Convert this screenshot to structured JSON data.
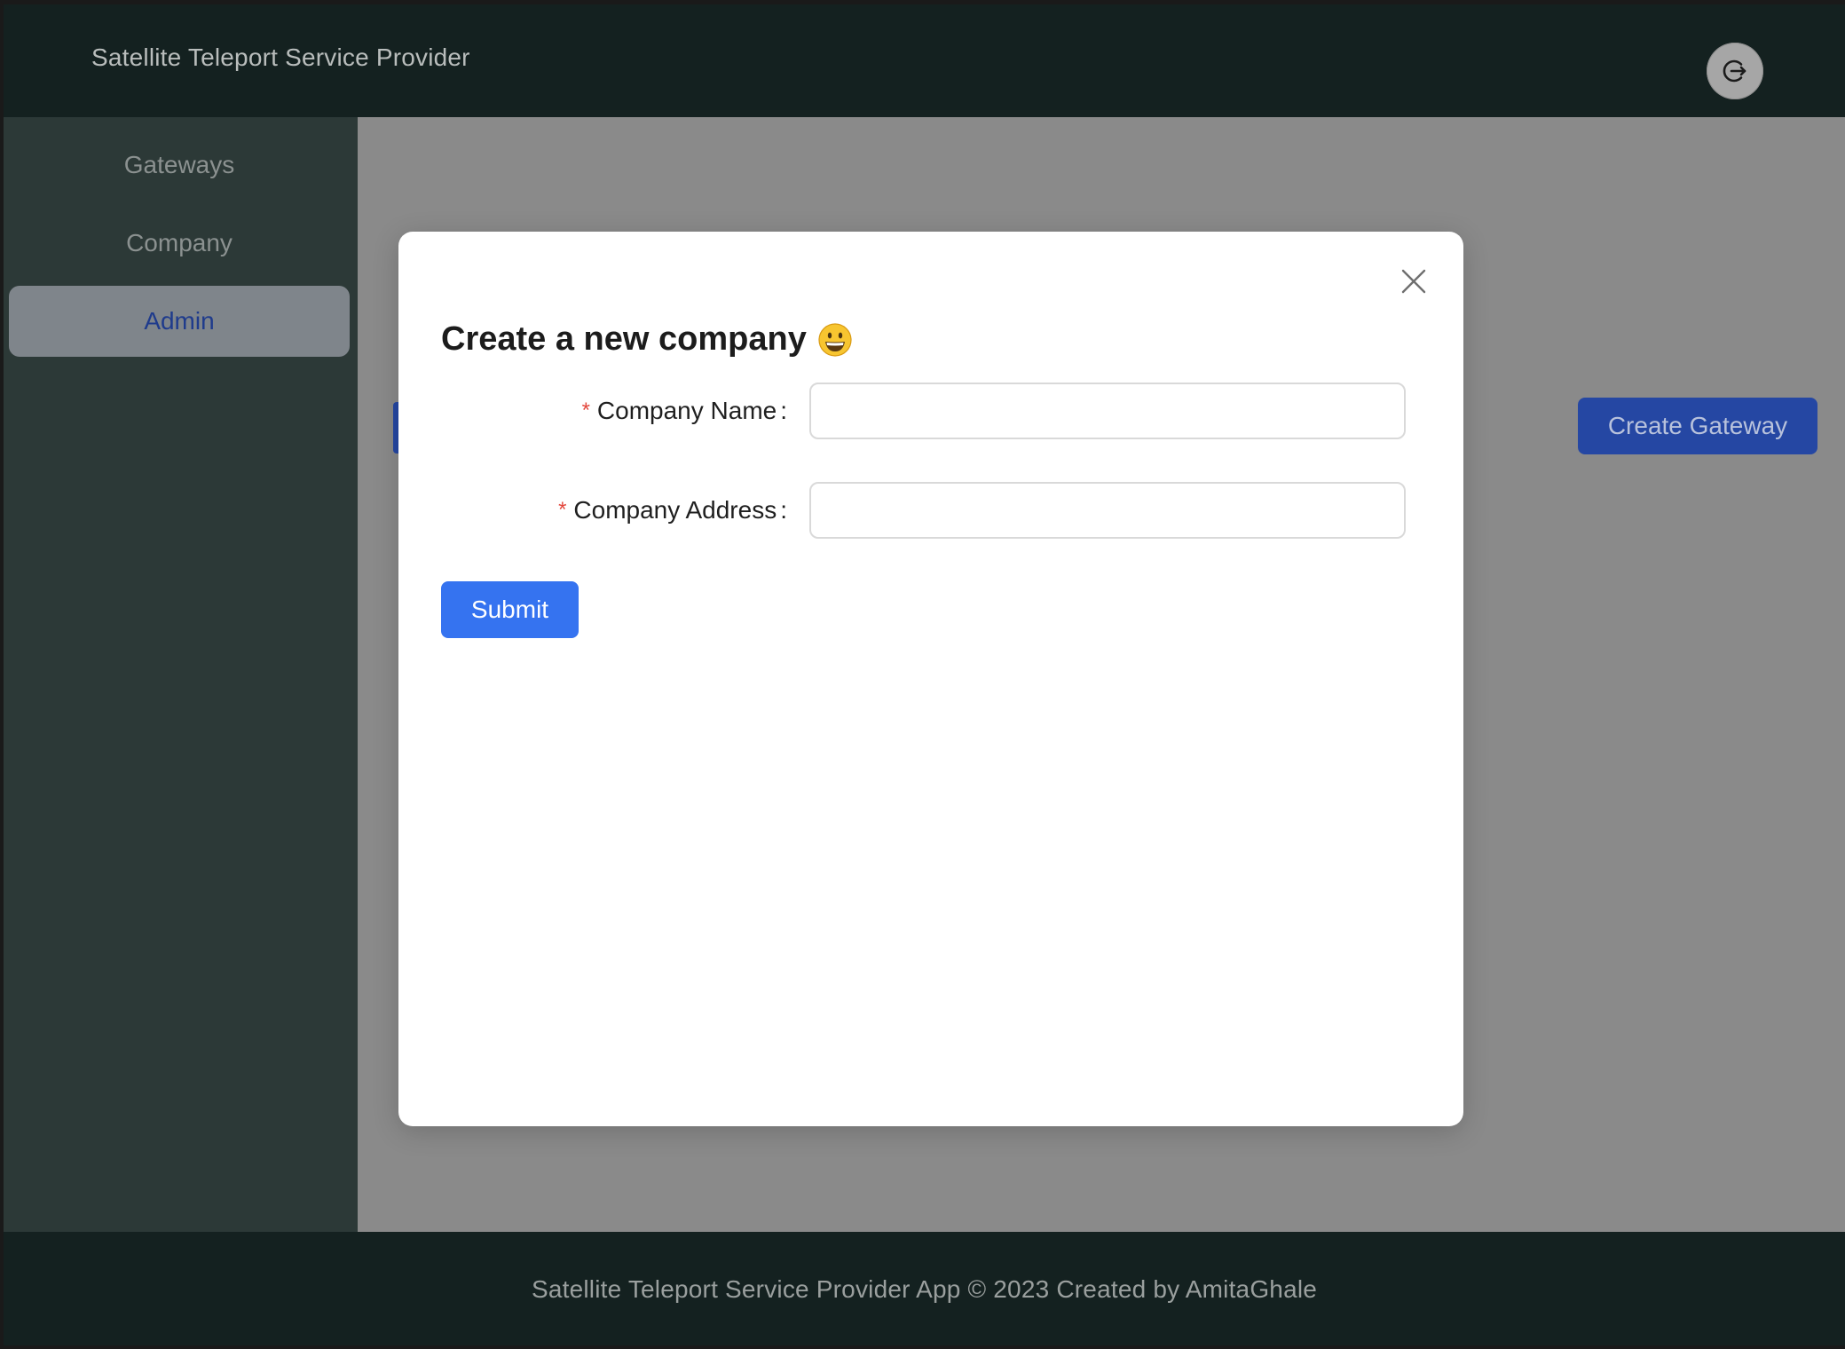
{
  "header": {
    "title": "Satellite Teleport Service Provider",
    "account_icon": "logout-icon"
  },
  "sidebar": {
    "items": [
      {
        "label": "Gateways",
        "active": false
      },
      {
        "label": "Company",
        "active": false
      },
      {
        "label": "Admin",
        "active": true
      }
    ]
  },
  "content": {
    "create_gateway_label": "Create Gateway"
  },
  "modal": {
    "title": "Create a new company",
    "title_icon": "grinning-face-emoji",
    "close_icon": "close-icon",
    "fields": [
      {
        "label": "Company Name",
        "required_mark": "*",
        "value": "",
        "placeholder": ""
      },
      {
        "label": "Company Address",
        "required_mark": "*",
        "value": "",
        "placeholder": ""
      }
    ],
    "submit_label": "Submit"
  },
  "footer": {
    "text": "Satellite Teleport Service Provider App © 2023 Created by AmitaGhale"
  },
  "colors": {
    "header_bg": "#142120",
    "sidebar_bg": "#2c3937",
    "overlay": "#8a8a8a",
    "primary": "#3573f0",
    "required": "#e3473c"
  }
}
